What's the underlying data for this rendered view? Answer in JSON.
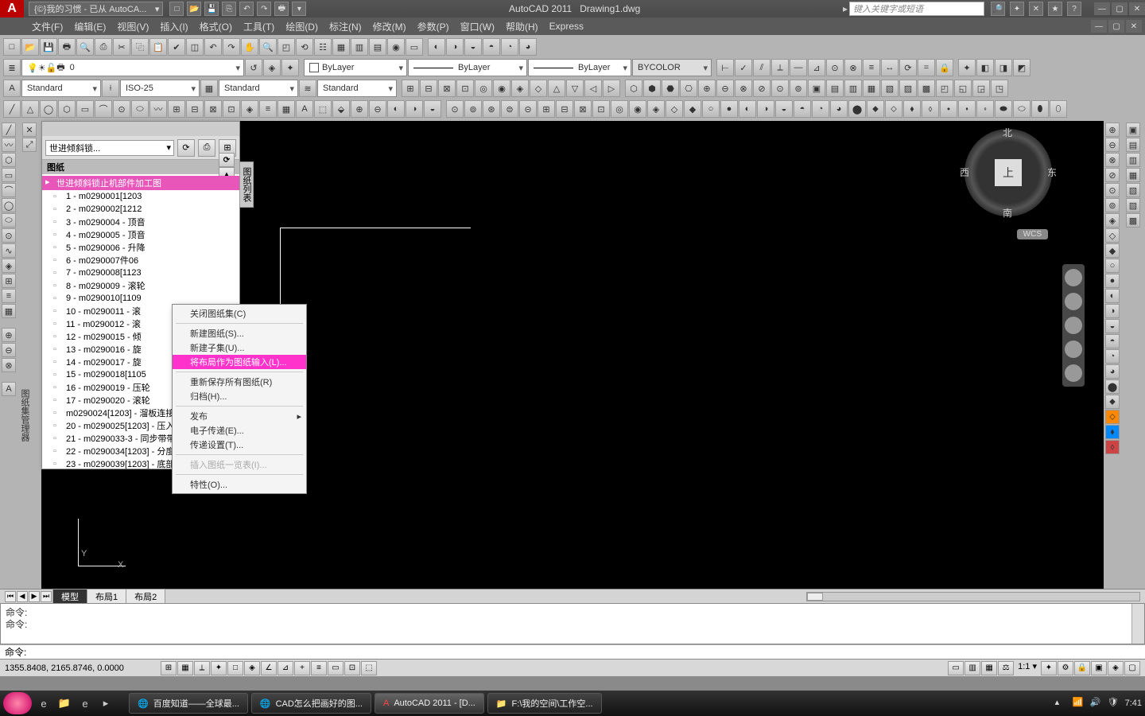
{
  "title": {
    "workspace": "{©}我的习惯 - 已从 AutoCA...",
    "app": "AutoCAD 2011",
    "doc": "Drawing1.dwg",
    "search_placeholder": "键入关键字或短语"
  },
  "menu": [
    "文件(F)",
    "编辑(E)",
    "视图(V)",
    "插入(I)",
    "格式(O)",
    "工具(T)",
    "绘图(D)",
    "标注(N)",
    "修改(M)",
    "参数(P)",
    "窗口(W)",
    "帮助(H)",
    "Express"
  ],
  "combos": {
    "layer": "0",
    "linecolor": "ByLayer",
    "linetype": "ByLayer",
    "lineweight": "ByLayer",
    "plotstyle": "BYCOLOR",
    "textstyle": "Standard",
    "dimstyle": "ISO-25",
    "tablestyle": "Standard",
    "mlstyle": "Standard"
  },
  "palette": {
    "title_combo": "世进倾斜锁...",
    "section": "图纸",
    "root": "世进倾斜锁止机部件加工图",
    "side_label": "图纸列表",
    "side_label2": "图纸集管理器",
    "items": [
      "1 - m0290001[1203",
      "2 - m0290002[1212",
      "3 - m0290004 - 顶音",
      "4 - m0290005 - 顶音",
      "5 - m0290006 - 升降",
      "6 - m0290007件06",
      "7 - m0290008[1123",
      "8 - m0290009 - 滚轮",
      "9 - m0290010[1109",
      "10 - m0290011 - 滚",
      "11 - m0290012 - 滚",
      "12 - m0290015 - 倾",
      "13 - m0290016 - 旋",
      "14 - m0290017 - 旋",
      "15 - m0290018[1105",
      "16 - m0290019 - 压轮",
      "17 - m0290020 - 滚轮",
      "m0290024[1203] - 溜板连接板",
      "20 - m0290025[1203] - 压入支",
      "21 - m0290033-3 - 同步带带轮",
      "22 - m0290034[1203] - 分度机",
      "23 - m0290039[1203] - 底部支"
    ]
  },
  "context_menu": [
    {
      "label": "关闭图纸集(C)",
      "type": "item"
    },
    {
      "type": "sep"
    },
    {
      "label": "新建图纸(S)...",
      "type": "item"
    },
    {
      "label": "新建子集(U)...",
      "type": "item"
    },
    {
      "label": "将布局作为图纸输入(L)...",
      "type": "item",
      "hl": true
    },
    {
      "type": "sep"
    },
    {
      "label": "重新保存所有图纸(R)",
      "type": "item"
    },
    {
      "label": "归档(H)...",
      "type": "item"
    },
    {
      "type": "sep"
    },
    {
      "label": "发布",
      "type": "sub"
    },
    {
      "label": "电子传递(E)...",
      "type": "item"
    },
    {
      "label": "传递设置(T)...",
      "type": "item"
    },
    {
      "type": "sep"
    },
    {
      "label": "插入图纸一览表(I)...",
      "type": "item",
      "dis": true
    },
    {
      "type": "sep"
    },
    {
      "label": "特性(O)...",
      "type": "item"
    }
  ],
  "viewcube": {
    "face": "上",
    "n": "北",
    "s": "南",
    "e": "东",
    "w": "西",
    "wcs": "WCS"
  },
  "ucs": {
    "x": "X",
    "y": "Y"
  },
  "tabs": {
    "nav": [
      "⏮",
      "◀",
      "▶",
      "⏭"
    ],
    "items": [
      "模型",
      "布局1",
      "布局2"
    ],
    "active": 0
  },
  "cmd": {
    "lines": [
      "命令:",
      "命令:"
    ],
    "prompt": "命令:"
  },
  "status": {
    "coords": "1355.8408, 2165.8746, 0.0000",
    "scale": "1:1"
  },
  "taskbar": {
    "tasks": [
      {
        "label": "百度知道——全球最..."
      },
      {
        "label": "CAD怎么把画好的图..."
      },
      {
        "label": "AutoCAD 2011 - [D...",
        "active": true
      },
      {
        "label": "F:\\我的空间\\工作空..."
      }
    ],
    "time": "7:41"
  }
}
